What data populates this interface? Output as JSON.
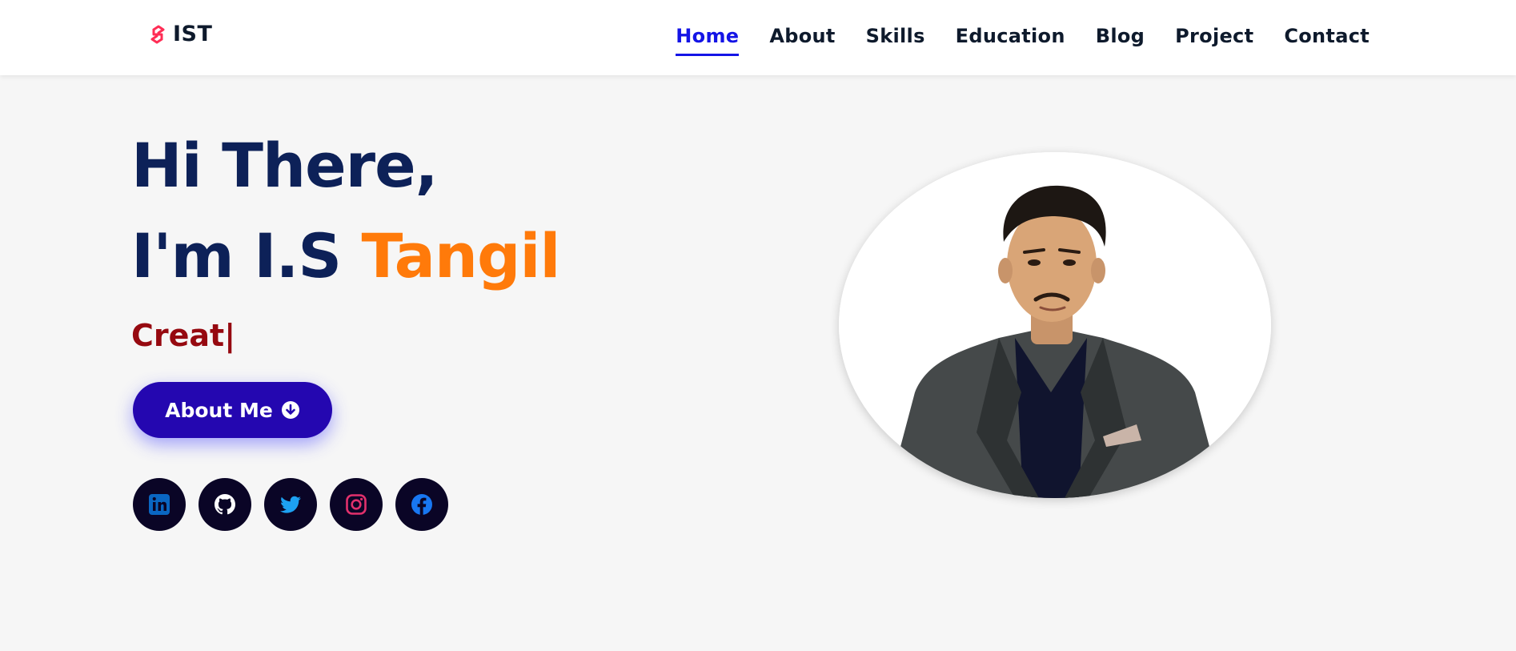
{
  "brand": {
    "text": "IST",
    "icon": "logo-s-icon",
    "icon_color": "#ff2d55"
  },
  "nav": {
    "items": [
      {
        "label": "Home",
        "active": true
      },
      {
        "label": "About",
        "active": false
      },
      {
        "label": "Skills",
        "active": false
      },
      {
        "label": "Education",
        "active": false
      },
      {
        "label": "Blog",
        "active": false
      },
      {
        "label": "Project",
        "active": false
      },
      {
        "label": "Contact",
        "active": false
      }
    ],
    "active_color": "#1414e6"
  },
  "hero": {
    "greeting": "Hi There,",
    "intro": "I'm I.S ",
    "name": "Tangil",
    "typing_text": "Creat|",
    "button_label": "About Me",
    "button_icon": "arrow-down-circle-icon"
  },
  "socials": [
    {
      "name": "linkedin-icon",
      "color": "#0a66c2"
    },
    {
      "name": "github-icon",
      "color": "#ffffff"
    },
    {
      "name": "twitter-icon",
      "color": "#1da1f2"
    },
    {
      "name": "instagram-icon",
      "color": "#e1306c"
    },
    {
      "name": "facebook-icon",
      "color": "#1877f2"
    }
  ],
  "profile_photo": {
    "name": "profile-photo"
  },
  "colors": {
    "heading": "#0d2158",
    "name_accent": "#ff7a0a",
    "typing": "#960910",
    "button_bg": "#2407b0"
  }
}
